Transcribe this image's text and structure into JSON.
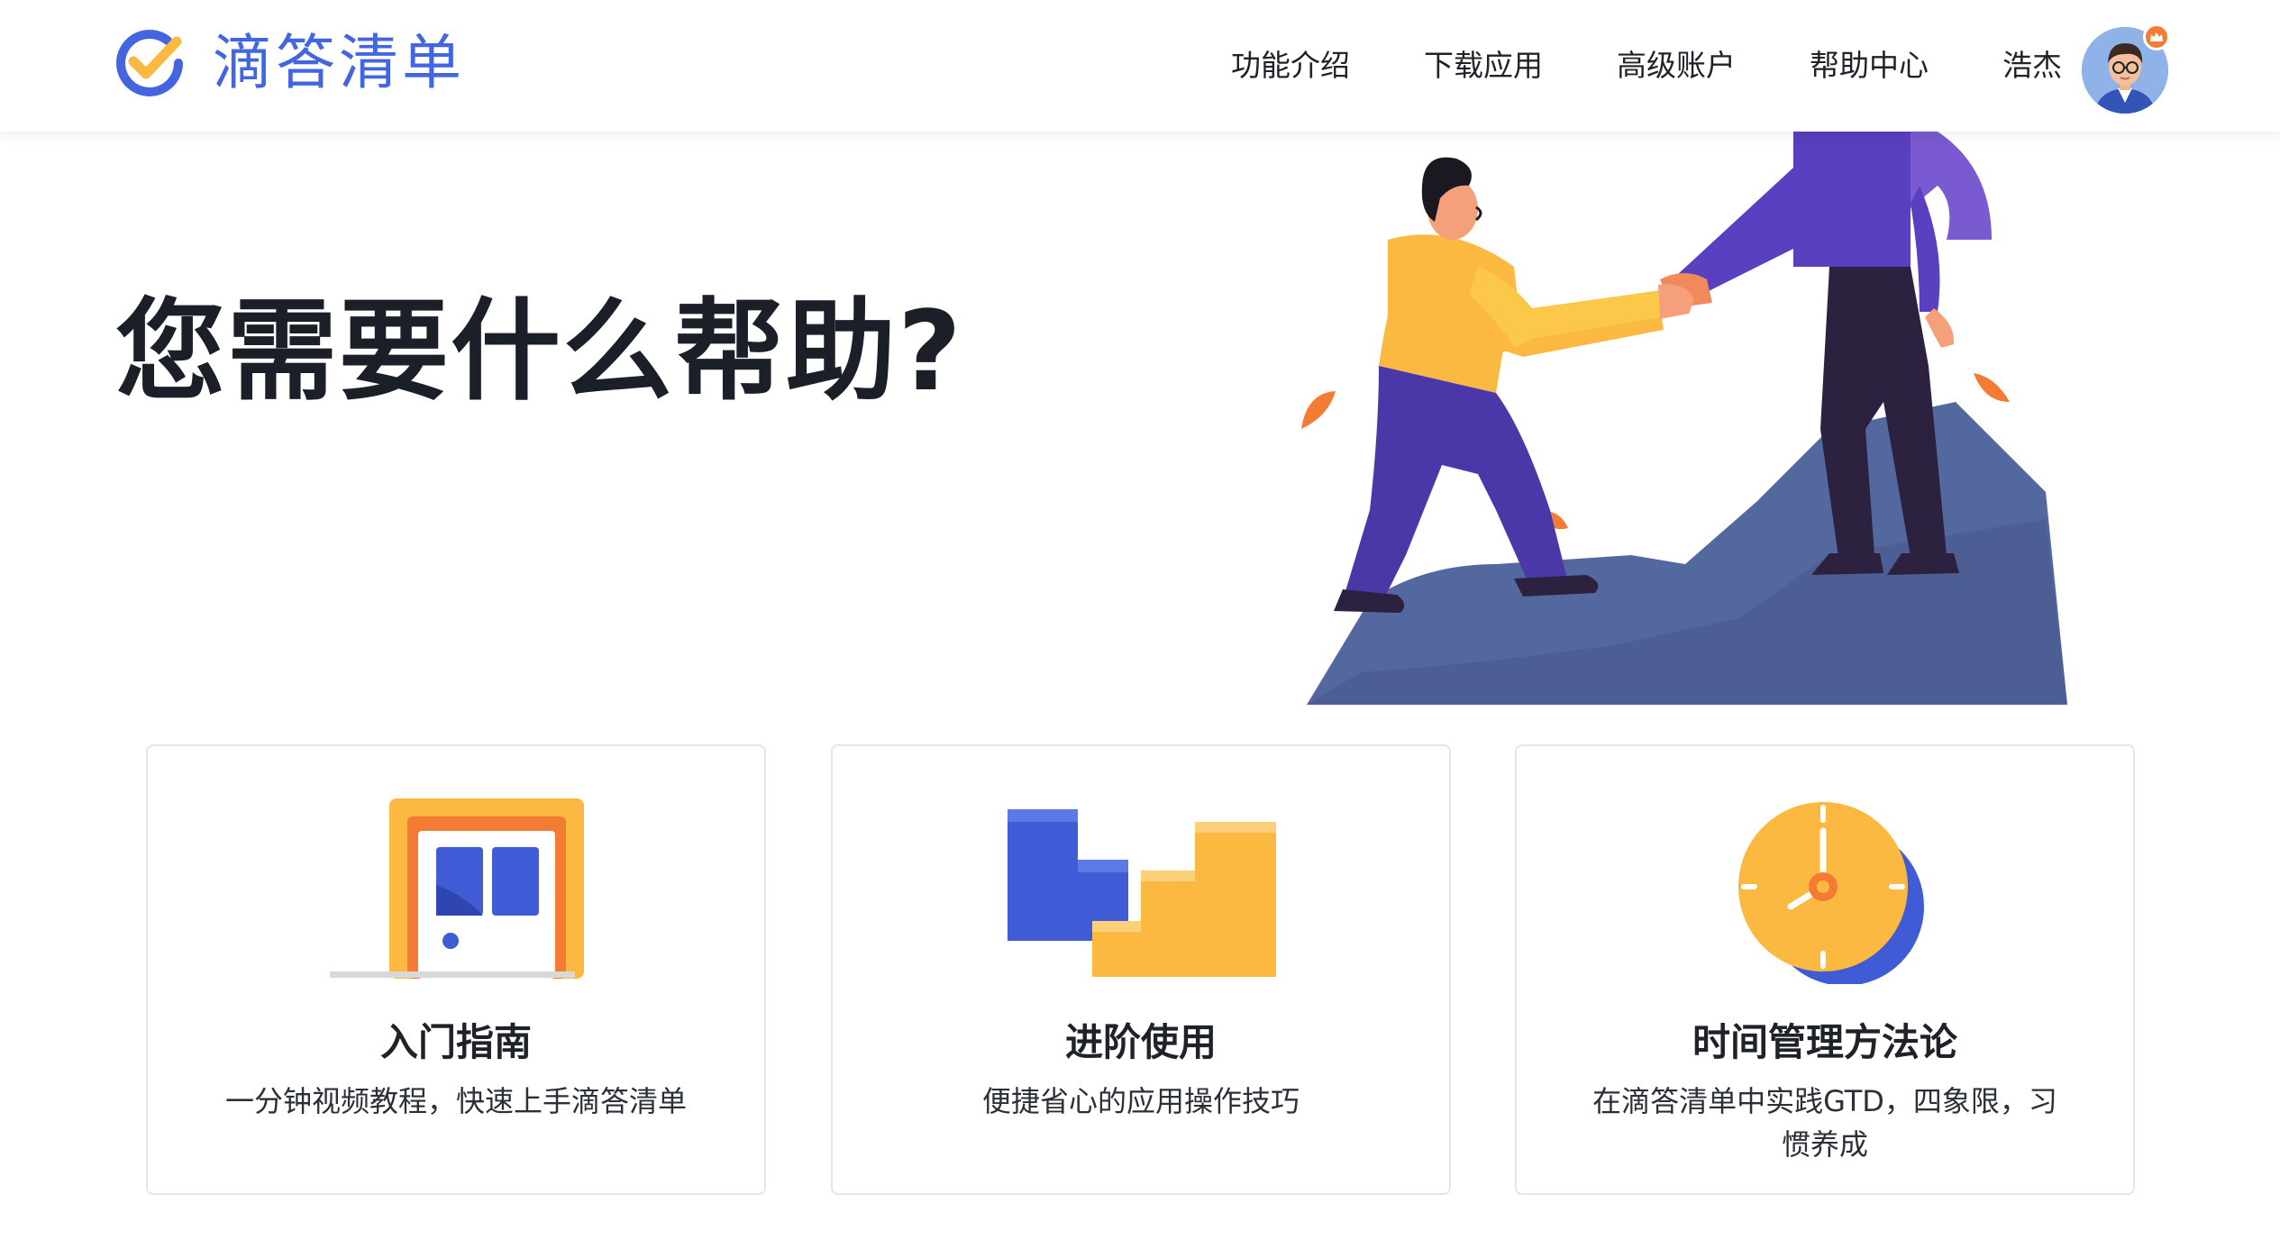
{
  "brand": {
    "name": "滴答清单",
    "color": "#4366e0",
    "logo_icon": "check-circle-icon"
  },
  "nav": {
    "items": [
      "功能介绍",
      "下载应用",
      "高级账户",
      "帮助中心"
    ],
    "user_name": "浩杰",
    "avatar_icon": "user-avatar-icon",
    "badge_icon": "crown-icon"
  },
  "hero": {
    "title": "您需要什么帮助?",
    "illustration": "two-people-handshake-on-mountain"
  },
  "cards": [
    {
      "title": "入门指南",
      "desc": "一分钟视频教程，快速上手滴答清单",
      "icon": "door-icon"
    },
    {
      "title": "进阶使用",
      "desc": "便捷省心的应用操作技巧",
      "icon": "steps-blocks-icon"
    },
    {
      "title": "时间管理方法论",
      "desc": "在滴答清单中实践GTD，四象限，习惯养成",
      "icon": "clock-icon"
    }
  ],
  "colors": {
    "accent": "#4366e0",
    "yellow": "#fbb942",
    "orange": "#f47b33",
    "purple": "#4f3bb0",
    "mountain": "#53689f"
  }
}
